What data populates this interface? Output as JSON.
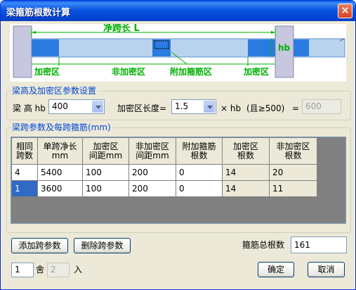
{
  "window": {
    "title": "梁箍筋根数计算",
    "close_glyph": "×"
  },
  "diagram": {
    "span_label": "净跨长 L",
    "hb_label": "hb",
    "labels": [
      "加密区",
      "非加密区",
      "附加箍筋区",
      "加密区"
    ]
  },
  "beam_group": {
    "title": "梁高及加密区参数设置",
    "height_label": "梁 高 hb",
    "height_value": "400",
    "dense_len_label": "加密区长度=",
    "dense_factor": "1.5",
    "times_hb": "× hb",
    "min_note": "(且≥500)",
    "equals": "=",
    "dense_result": "600"
  },
  "span_group": {
    "title": "梁跨参数及每跨箍筋(mm)",
    "columns": [
      {
        "line1": "相同",
        "line2": "跨数"
      },
      {
        "line1": "单跨净长",
        "line2": "mm"
      },
      {
        "line1": "加密区",
        "line2": "间距mm"
      },
      {
        "line1": "非加密区",
        "line2": "间距mm"
      },
      {
        "line1": "附加箍筋",
        "line2": "根数"
      },
      {
        "line1": "加密区",
        "line2": "根数"
      },
      {
        "line1": "非加密区",
        "line2": "根数"
      }
    ],
    "rows": [
      [
        "4",
        "5400",
        "100",
        "200",
        "0",
        "14",
        "20"
      ],
      [
        "1",
        "3600",
        "100",
        "200",
        "0",
        "14",
        "11"
      ]
    ]
  },
  "buttons": {
    "add": "添加跨参数",
    "delete": "删除跨参数",
    "ok": "确定",
    "cancel": "取消"
  },
  "total": {
    "label": "箍筋总根数",
    "value": "161"
  },
  "rounding": {
    "value1": "1",
    "label1": "舍",
    "value2": "2",
    "label2": "入"
  }
}
